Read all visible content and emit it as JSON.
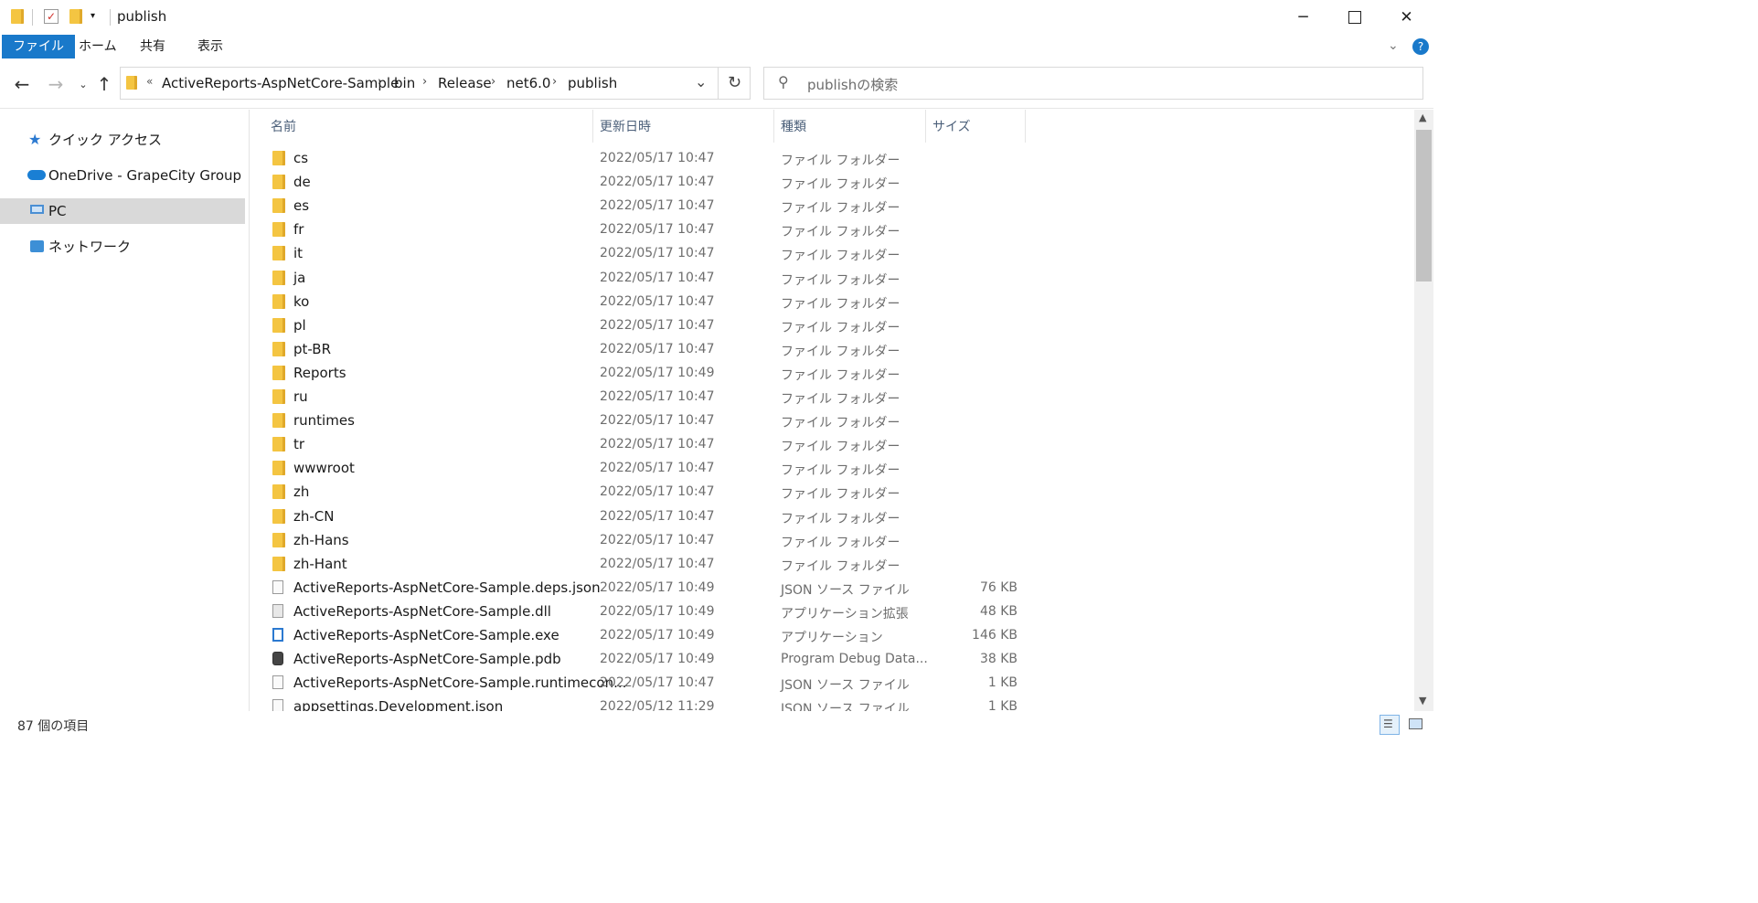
{
  "window": {
    "title": "publish"
  },
  "ribbon": {
    "tabs": [
      "ファイル",
      "ホーム",
      "共有",
      "表示"
    ]
  },
  "address": {
    "overflow": "«",
    "path": [
      "ActiveReports-AspNetCore-Sample",
      "bin",
      "Release",
      "net6.0",
      "publish"
    ]
  },
  "search": {
    "placeholder": "publishの検索"
  },
  "sidebar": {
    "items": [
      {
        "label": "クイック アクセス",
        "icon": "star-icon"
      },
      {
        "label": "OneDrive - GrapeCity Group",
        "icon": "cloud-icon"
      },
      {
        "label": "PC",
        "icon": "computer-icon"
      },
      {
        "label": "ネットワーク",
        "icon": "network-icon"
      }
    ]
  },
  "columns": {
    "name": "名前",
    "date": "更新日時",
    "type": "種類",
    "size": "サイズ"
  },
  "files": [
    {
      "name": "cs",
      "date": "2022/05/17 10:47",
      "type": "ファイル フォルダー",
      "size": "",
      "icon": "folder-icon"
    },
    {
      "name": "de",
      "date": "2022/05/17 10:47",
      "type": "ファイル フォルダー",
      "size": "",
      "icon": "folder-icon"
    },
    {
      "name": "es",
      "date": "2022/05/17 10:47",
      "type": "ファイル フォルダー",
      "size": "",
      "icon": "folder-icon"
    },
    {
      "name": "fr",
      "date": "2022/05/17 10:47",
      "type": "ファイル フォルダー",
      "size": "",
      "icon": "folder-icon"
    },
    {
      "name": "it",
      "date": "2022/05/17 10:47",
      "type": "ファイル フォルダー",
      "size": "",
      "icon": "folder-icon"
    },
    {
      "name": "ja",
      "date": "2022/05/17 10:47",
      "type": "ファイル フォルダー",
      "size": "",
      "icon": "folder-icon"
    },
    {
      "name": "ko",
      "date": "2022/05/17 10:47",
      "type": "ファイル フォルダー",
      "size": "",
      "icon": "folder-icon"
    },
    {
      "name": "pl",
      "date": "2022/05/17 10:47",
      "type": "ファイル フォルダー",
      "size": "",
      "icon": "folder-icon"
    },
    {
      "name": "pt-BR",
      "date": "2022/05/17 10:47",
      "type": "ファイル フォルダー",
      "size": "",
      "icon": "folder-icon"
    },
    {
      "name": "Reports",
      "date": "2022/05/17 10:49",
      "type": "ファイル フォルダー",
      "size": "",
      "icon": "folder-icon"
    },
    {
      "name": "ru",
      "date": "2022/05/17 10:47",
      "type": "ファイル フォルダー",
      "size": "",
      "icon": "folder-icon"
    },
    {
      "name": "runtimes",
      "date": "2022/05/17 10:47",
      "type": "ファイル フォルダー",
      "size": "",
      "icon": "folder-icon"
    },
    {
      "name": "tr",
      "date": "2022/05/17 10:47",
      "type": "ファイル フォルダー",
      "size": "",
      "icon": "folder-icon"
    },
    {
      "name": "wwwroot",
      "date": "2022/05/17 10:47",
      "type": "ファイル フォルダー",
      "size": "",
      "icon": "folder-icon"
    },
    {
      "name": "zh",
      "date": "2022/05/17 10:47",
      "type": "ファイル フォルダー",
      "size": "",
      "icon": "folder-icon"
    },
    {
      "name": "zh-CN",
      "date": "2022/05/17 10:47",
      "type": "ファイル フォルダー",
      "size": "",
      "icon": "folder-icon"
    },
    {
      "name": "zh-Hans",
      "date": "2022/05/17 10:47",
      "type": "ファイル フォルダー",
      "size": "",
      "icon": "folder-icon"
    },
    {
      "name": "zh-Hant",
      "date": "2022/05/17 10:47",
      "type": "ファイル フォルダー",
      "size": "",
      "icon": "folder-icon"
    },
    {
      "name": "ActiveReports-AspNetCore-Sample.deps.json",
      "date": "2022/05/17 10:49",
      "type": "JSON ソース ファイル",
      "size": "76 KB",
      "icon": "json-file-icon"
    },
    {
      "name": "ActiveReports-AspNetCore-Sample.dll",
      "date": "2022/05/17 10:49",
      "type": "アプリケーション拡張",
      "size": "48 KB",
      "icon": "dll-file-icon"
    },
    {
      "name": "ActiveReports-AspNetCore-Sample.exe",
      "date": "2022/05/17 10:49",
      "type": "アプリケーション",
      "size": "146 KB",
      "icon": "exe-file-icon"
    },
    {
      "name": "ActiveReports-AspNetCore-Sample.pdb",
      "date": "2022/05/17 10:49",
      "type": "Program Debug Data...",
      "size": "38 KB",
      "icon": "pdb-file-icon"
    },
    {
      "name": "ActiveReports-AspNetCore-Sample.runtimecon...",
      "date": "2022/05/17 10:47",
      "type": "JSON ソース ファイル",
      "size": "1 KB",
      "icon": "json-file-icon"
    },
    {
      "name": "appsettings.Development.json",
      "date": "2022/05/12 11:29",
      "type": "JSON ソース ファイル",
      "size": "1 KB",
      "icon": "json-file-icon"
    }
  ],
  "status": {
    "item_count": "87 個の項目"
  },
  "colors": {
    "accent": "#1979ca",
    "selected_nav": "#d9d9d9",
    "folder": "#f4c542",
    "column_header": "#4c607a"
  }
}
